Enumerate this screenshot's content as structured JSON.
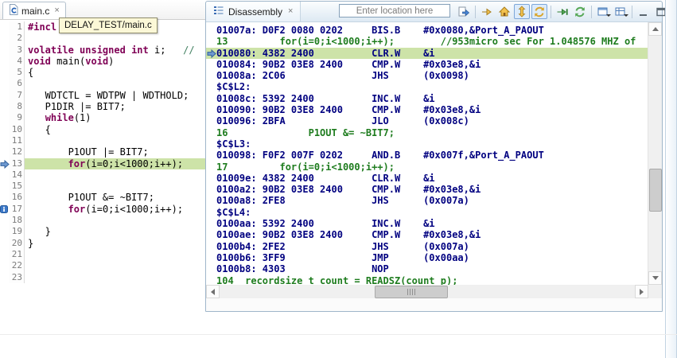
{
  "colors": {
    "highlight_green": "#cde3a8",
    "keyword_purple": "#7f0055",
    "comment_green": "#3f7f5f",
    "disasm_navy": "#000080",
    "disasm_source_green": "#1e7c1e"
  },
  "editor": {
    "tab": {
      "label": "main.c",
      "close": "×"
    },
    "tooltip": "DELAY_TEST/main.c",
    "lines": [
      {
        "num": "1",
        "segs": [
          [
            "#incl",
            "directive"
          ]
        ]
      },
      {
        "num": "2",
        "segs": []
      },
      {
        "num": "3",
        "segs": [
          [
            "volatile",
            "kw"
          ],
          [
            " ",
            ""
          ],
          [
            "unsigned",
            "kw"
          ],
          [
            " ",
            ""
          ],
          [
            "int",
            "kw"
          ],
          [
            " i;   ",
            ""
          ],
          [
            "//",
            "comment"
          ]
        ]
      },
      {
        "num": "4",
        "segs": [
          [
            "void",
            "kw"
          ],
          [
            " main(",
            ""
          ],
          [
            "void",
            "kw"
          ],
          [
            ")",
            ""
          ]
        ]
      },
      {
        "num": "5",
        "segs": [
          [
            "{",
            ""
          ]
        ]
      },
      {
        "num": "6",
        "segs": []
      },
      {
        "num": "7",
        "segs": [
          [
            "   WDTCTL = WDTPW | WDTHOLD;",
            ""
          ]
        ]
      },
      {
        "num": "8",
        "segs": [
          [
            "   P1DIR |= BIT7;",
            ""
          ]
        ]
      },
      {
        "num": "9",
        "segs": [
          [
            "   ",
            ""
          ],
          [
            "while",
            "kw"
          ],
          [
            "(1)",
            ""
          ]
        ]
      },
      {
        "num": "10",
        "segs": [
          [
            "   {",
            ""
          ]
        ]
      },
      {
        "num": "11",
        "segs": []
      },
      {
        "num": "12",
        "segs": [
          [
            "       P1OUT |= BIT7;",
            ""
          ]
        ]
      },
      {
        "num": "13",
        "highlight": true,
        "marker": "pc-arrow",
        "segs": [
          [
            "       ",
            ""
          ],
          [
            "for",
            "kw"
          ],
          [
            "(i=0;i<1000;i++);",
            ""
          ]
        ]
      },
      {
        "num": "14",
        "segs": []
      },
      {
        "num": "15",
        "segs": []
      },
      {
        "num": "16",
        "segs": [
          [
            "       P1OUT &= ~BIT7;",
            ""
          ]
        ]
      },
      {
        "num": "17",
        "marker": "info",
        "segs": [
          [
            "       ",
            ""
          ],
          [
            "for",
            "kw"
          ],
          [
            "(i=0;i<1000;i++);",
            ""
          ]
        ]
      },
      {
        "num": "18",
        "segs": []
      },
      {
        "num": "19",
        "segs": [
          [
            "   }",
            ""
          ]
        ]
      },
      {
        "num": "20",
        "segs": [
          [
            "}",
            ""
          ]
        ]
      },
      {
        "num": "21",
        "segs": []
      },
      {
        "num": "22",
        "segs": []
      },
      {
        "num": "23",
        "segs": []
      }
    ]
  },
  "disassembly": {
    "tab": {
      "label": "Disassembly",
      "close": "×"
    },
    "location_placeholder": "Enter location here",
    "toolbar": [
      {
        "name": "show-location-icon"
      },
      {
        "sep": true
      },
      {
        "name": "go-to-pc-icon"
      },
      {
        "name": "home-icon"
      },
      {
        "name": "lock-scroll-icon",
        "pressed": true
      },
      {
        "name": "auto-sync-icon",
        "pressed": true
      },
      {
        "sep": true
      },
      {
        "name": "step-over-icon"
      },
      {
        "name": "refresh-icon"
      },
      {
        "sep": true
      },
      {
        "name": "memory-config-icon",
        "caret": true
      },
      {
        "name": "display-options-icon",
        "caret": true
      },
      {
        "sep": true
      },
      {
        "name": "minimize-icon"
      },
      {
        "name": "maximize-icon"
      }
    ],
    "rows": [
      {
        "type": "instr",
        "addr": "01007a:",
        "code": "D0F2 0080 0202",
        "mn": "BIS.B",
        "op": "#0x0080,&Port_A_PAOUT"
      },
      {
        "type": "src",
        "text": "13         for(i=0;i<1000;i++);        //953micro sec For 1.048576 MHZ of"
      },
      {
        "type": "instr",
        "current": true,
        "addr": "010080:",
        "code": "4382 2400",
        "mn": "CLR.W",
        "op": "&i"
      },
      {
        "type": "instr",
        "addr": "010084:",
        "code": "90B2 03E8 2400",
        "mn": "CMP.W",
        "op": "#0x03e8,&i"
      },
      {
        "type": "instr",
        "addr": "01008a:",
        "code": "2C06",
        "mn": "JHS",
        "op": "(0x0098)"
      },
      {
        "type": "label",
        "text": "$C$L2:"
      },
      {
        "type": "instr",
        "addr": "01008c:",
        "code": "5392 2400",
        "mn": "INC.W",
        "op": "&i"
      },
      {
        "type": "instr",
        "addr": "010090:",
        "code": "90B2 03E8 2400",
        "mn": "CMP.W",
        "op": "#0x03e8,&i"
      },
      {
        "type": "instr",
        "addr": "010096:",
        "code": "2BFA",
        "mn": "JLO",
        "op": "(0x008c)"
      },
      {
        "type": "src",
        "text": "16              P1OUT &= ~BIT7;"
      },
      {
        "type": "label",
        "text": "$C$L3:"
      },
      {
        "type": "instr",
        "addr": "010098:",
        "code": "F0F2 007F 0202",
        "mn": "AND.B",
        "op": "#0x007f,&Port_A_PAOUT"
      },
      {
        "type": "src",
        "text": "17         for(i=0;i<1000;i++);"
      },
      {
        "type": "instr",
        "addr": "01009e:",
        "code": "4382 2400",
        "mn": "CLR.W",
        "op": "&i"
      },
      {
        "type": "instr",
        "addr": "0100a2:",
        "code": "90B2 03E8 2400",
        "mn": "CMP.W",
        "op": "#0x03e8,&i"
      },
      {
        "type": "instr",
        "addr": "0100a8:",
        "code": "2FE8",
        "mn": "JHS",
        "op": "(0x007a)"
      },
      {
        "type": "label",
        "text": "$C$L4:"
      },
      {
        "type": "instr",
        "addr": "0100aa:",
        "code": "5392 2400",
        "mn": "INC.W",
        "op": "&i"
      },
      {
        "type": "instr",
        "addr": "0100ae:",
        "code": "90B2 03E8 2400",
        "mn": "CMP.W",
        "op": "#0x03e8,&i"
      },
      {
        "type": "instr",
        "addr": "0100b4:",
        "code": "2FE2",
        "mn": "JHS",
        "op": "(0x007a)"
      },
      {
        "type": "instr",
        "addr": "0100b6:",
        "code": "3FF9",
        "mn": "JMP",
        "op": "(0x00aa)"
      },
      {
        "type": "instr",
        "addr": "0100b8:",
        "code": "4303",
        "mn": "NOP",
        "op": ""
      },
      {
        "type": "src",
        "text": "104  recordsize_t count = READSZ(count_p);"
      }
    ]
  }
}
